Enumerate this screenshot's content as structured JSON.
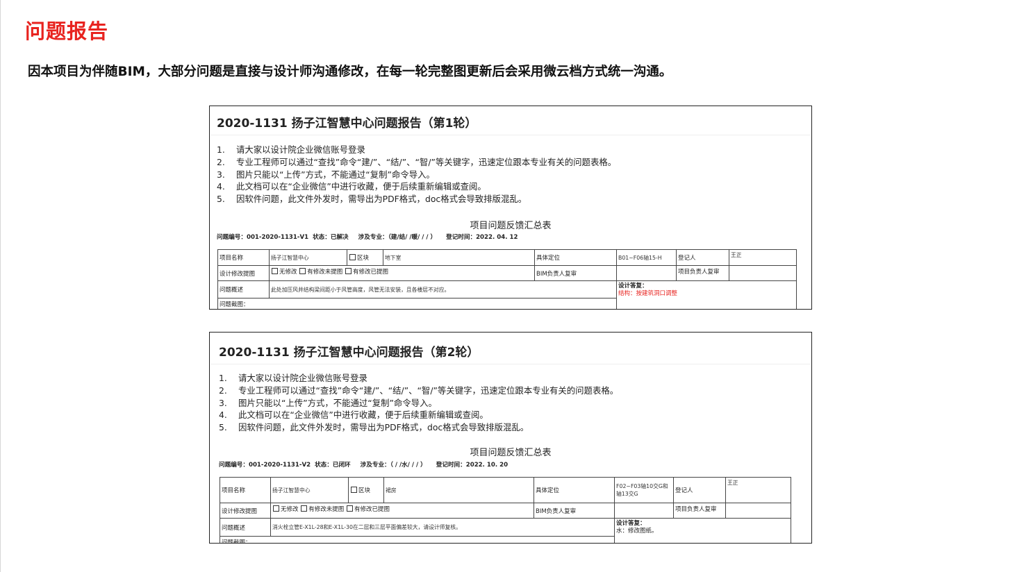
{
  "page": {
    "title": "问题报告",
    "subtitle": "因本项目为伴随BIM，大部分问题是直接与设计师沟通修改，在每一轮完整图更新后会采用微云档方式统一沟通。"
  },
  "reports": [
    {
      "title": "2020-1131  扬子江智慧中心问题报告（第1轮）",
      "notes": [
        {
          "num": "1.",
          "text": "请大家以设计院企业微信账号登录"
        },
        {
          "num": "2.",
          "text": "专业工程师可以通过“查找”命令“建/”、“结/”、“智/”等关键字，迅速定位跟本专业有关的问题表格。"
        },
        {
          "num": "3.",
          "text": "图片只能以“上传”方式，不能通过“复制”命令导入。"
        },
        {
          "num": "4.",
          "text": "此文档可以在“企业微信”中进行收藏，便于后续重新编辑或查阅。"
        },
        {
          "num": "5.",
          "text": "因软件问题，此文件外发时，需导出为PDF格式，doc格式会导致排版混乱。"
        }
      ],
      "summary_title": "项目问题反馈汇总表",
      "meta": {
        "issue_no": "问题编号：001-2020-1131-V1",
        "status": "状态：已解决",
        "discipline": "涉及专业：（建/结/  /暖/  /  /  ）",
        "date": "登记时间：2022. 04. 12"
      },
      "table": {
        "project_name_label": "项目名称",
        "project_name": "扬子江智慧中心",
        "zone_label": "区块",
        "zone": "地下室",
        "location_label": "具体定位",
        "location": "B01~F06轴15-H",
        "registrar_label": "登记人",
        "registrar": "王正",
        "design_mod_label": "设计修改提图",
        "opt_no_mod": "无修改",
        "opt_mod_no_pic": "有修改未提图",
        "opt_mod_pic": "有修改已提图",
        "bim_review_label": "BIM负责人复审",
        "pm_review_label": "项目负责人复审",
        "summary_label": "问题概述",
        "summary": "此处加压风井结构梁间距小于风管高度，风管无法安装，且各楼层不对应。",
        "reply_label": "设计答复：",
        "reply": "结构：按建筑洞口调整",
        "screenshot_label": "问题截图："
      }
    },
    {
      "title": "2020-1131  扬子江智慧中心问题报告（第2轮）",
      "notes": [
        {
          "num": "1.",
          "text": "请大家以设计院企业微信账号登录"
        },
        {
          "num": "2.",
          "text": "专业工程师可以通过“查找”命令“建/”、“结/”、“智/”等关键字，迅速定位跟本专业有关的问题表格。"
        },
        {
          "num": "3.",
          "text": "图片只能以“上传”方式，不能通过“复制”命令导入。"
        },
        {
          "num": "4.",
          "text": "此文档可以在“企业微信”中进行收藏，便于后续重新编辑或查阅。"
        },
        {
          "num": "5.",
          "text": "因软件问题，此文件外发时，需导出为PDF格式，doc格式会导致排版混乱。"
        }
      ],
      "summary_title": "项目问题反馈汇总表",
      "meta": {
        "issue_no": "问题编号：001-2020-1131-V2",
        "status": "状态：已闭环",
        "discipline": "涉及专业：（  /  /水/  /  /  ）",
        "date": "登记时间：2022. 10. 20"
      },
      "table": {
        "project_name_label": "项目名称",
        "project_name": "扬子江智慧中心",
        "zone_label": "区块",
        "zone": "裙房",
        "location_label": "具体定位",
        "location": "F02~F03轴10交G和轴13交G",
        "registrar_label": "登记人",
        "registrar": "王正",
        "design_mod_label": "设计修改提图",
        "opt_no_mod": "无修改",
        "opt_mod_no_pic": "有修改未提图",
        "opt_mod_pic": "有修改已提图",
        "bim_review_label": "BIM负责人复审",
        "pm_review_label": "项目负责人复审",
        "summary_label": "问题概述",
        "summary": "消火栓立管E-X1L-28和E-X1L-30在二层和三层平面偏差较大，请设计师复核。",
        "reply_label": "设计答复：",
        "reply": "水：修改图纸。",
        "screenshot_label": "问题截图："
      }
    }
  ]
}
